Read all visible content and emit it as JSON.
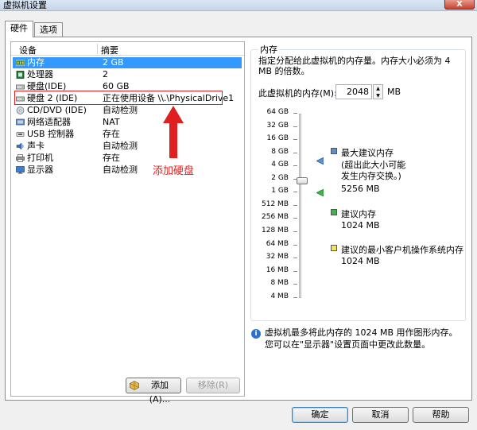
{
  "window": {
    "title": "虚拟机设置",
    "close_glyph": "X"
  },
  "tabs": [
    {
      "label": "硬件"
    },
    {
      "label": "选项"
    }
  ],
  "device_table": {
    "header_device": "设备",
    "header_summary": "摘要",
    "rows": [
      {
        "name": "内存",
        "summary": "2 GB",
        "icon": "memory-icon"
      },
      {
        "name": "处理器",
        "summary": "2",
        "icon": "processor-icon"
      },
      {
        "name": "硬盘(IDE)",
        "summary": "60 GB",
        "icon": "hard-disk-icon"
      },
      {
        "name": "硬盘 2 (IDE)",
        "summary": "正在使用设备 \\\\.\\PhysicalDrive1",
        "icon": "hard-disk-icon"
      },
      {
        "name": "CD/DVD (IDE)",
        "summary": "自动检测",
        "icon": "cd-dvd-icon"
      },
      {
        "name": "网络适配器",
        "summary": "NAT",
        "icon": "network-adapter-icon"
      },
      {
        "name": "USB 控制器",
        "summary": "存在",
        "icon": "usb-icon"
      },
      {
        "name": "声卡",
        "summary": "自动检测",
        "icon": "sound-card-icon"
      },
      {
        "name": "打印机",
        "summary": "存在",
        "icon": "printer-icon"
      },
      {
        "name": "显示器",
        "summary": "自动检测",
        "icon": "display-icon"
      }
    ]
  },
  "annotation": {
    "text": "添加硬盘",
    "color": "#e02020"
  },
  "buttons": {
    "add": "添加(A)...",
    "remove": "移除(R)",
    "ok": "确定",
    "cancel": "取消",
    "help": "帮助"
  },
  "memory": {
    "group_title": "内存",
    "description": "指定分配给此虚拟机的内存量。内存大小必须为 4 MB 的倍数。",
    "field_label": "此虚拟机的内存(M):",
    "value": "2048",
    "unit": "MB",
    "ticks": [
      "64 GB",
      "32 GB",
      "16 GB",
      "8 GB",
      "4 GB",
      "2 GB",
      "1 GB",
      "512 MB",
      "256 MB",
      "128 MB",
      "64 MB",
      "32 MB",
      "16 MB",
      "8 MB",
      "4 MB"
    ],
    "max_recommended": {
      "title": "最大建议内存",
      "note_line1": "(超出此大小可能",
      "note_line2": "发生内存交换。)",
      "value": "5256 MB",
      "color": "#5b8fd0"
    },
    "recommended": {
      "title": "建议内存",
      "value": "1024 MB",
      "color": "#3bb54a"
    },
    "min_guest": {
      "title": "建议的最小客户机操作系统内存",
      "value": "1024 MB",
      "color": "#f2e35a"
    },
    "info": "虚拟机最多将此内存的 1024 MB 用作图形内存。您可以在\"显示器\"设置页面中更改此数量。"
  }
}
